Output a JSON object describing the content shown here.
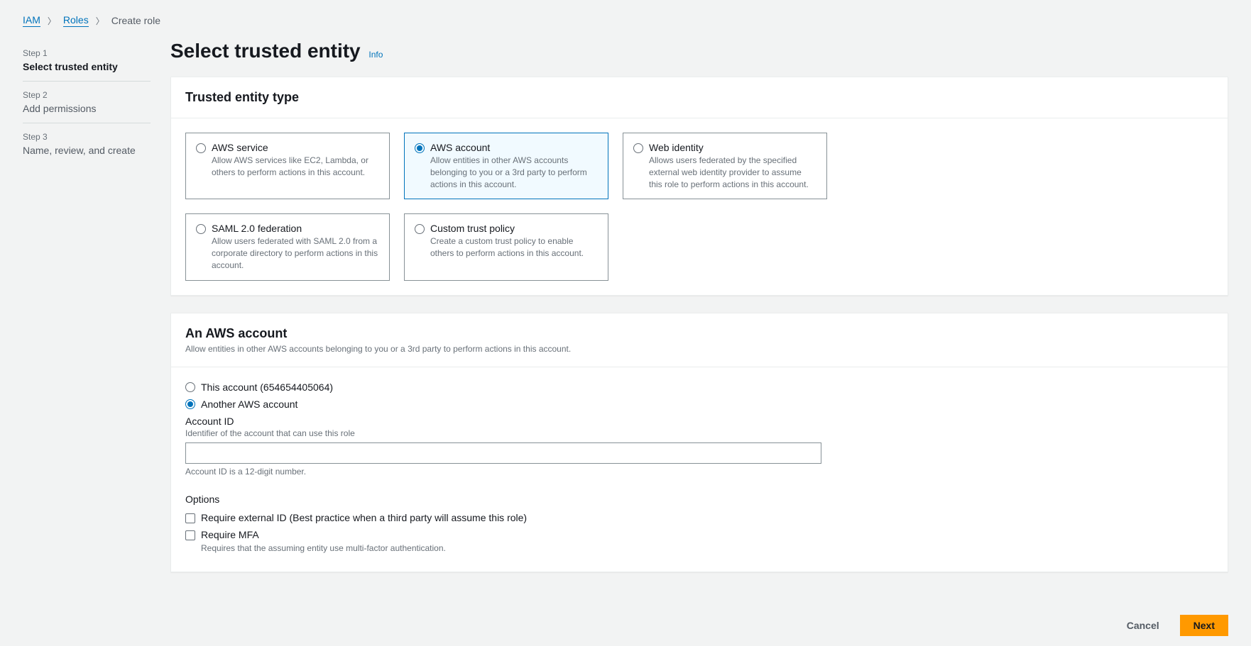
{
  "breadcrumb": {
    "iam": "IAM",
    "roles": "Roles",
    "current": "Create role"
  },
  "sidebar": {
    "steps": [
      {
        "label": "Step 1",
        "title": "Select trusted entity",
        "active": true
      },
      {
        "label": "Step 2",
        "title": "Add permissions",
        "active": false
      },
      {
        "label": "Step 3",
        "title": "Name, review, and create",
        "active": false
      }
    ]
  },
  "page": {
    "title": "Select trusted entity",
    "info": "Info"
  },
  "entity_panel": {
    "heading": "Trusted entity type",
    "tiles": [
      {
        "title": "AWS service",
        "desc": "Allow AWS services like EC2, Lambda, or others to perform actions in this account.",
        "selected": false
      },
      {
        "title": "AWS account",
        "desc": "Allow entities in other AWS accounts belonging to you or a 3rd party to perform actions in this account.",
        "selected": true
      },
      {
        "title": "Web identity",
        "desc": "Allows users federated by the specified external web identity provider to assume this role to perform actions in this account.",
        "selected": false
      },
      {
        "title": "SAML 2.0 federation",
        "desc": "Allow users federated with SAML 2.0 from a corporate directory to perform actions in this account.",
        "selected": false
      },
      {
        "title": "Custom trust policy",
        "desc": "Create a custom trust policy to enable others to perform actions in this account.",
        "selected": false
      }
    ]
  },
  "account_panel": {
    "heading": "An AWS account",
    "desc": "Allow entities in other AWS accounts belonging to you or a 3rd party to perform actions in this account.",
    "this_account_label": "This account (654654405064)",
    "another_account_label": "Another AWS account",
    "account_id_label": "Account ID",
    "account_id_hint": "Identifier of the account that can use this role",
    "account_id_value": "",
    "account_id_helper": "Account ID is a 12-digit number.",
    "options_title": "Options",
    "require_external_id": "Require external ID (Best practice when a third party will assume this role)",
    "require_mfa": "Require MFA",
    "require_mfa_sub": "Requires that the assuming entity use multi-factor authentication."
  },
  "footer": {
    "cancel": "Cancel",
    "next": "Next"
  }
}
